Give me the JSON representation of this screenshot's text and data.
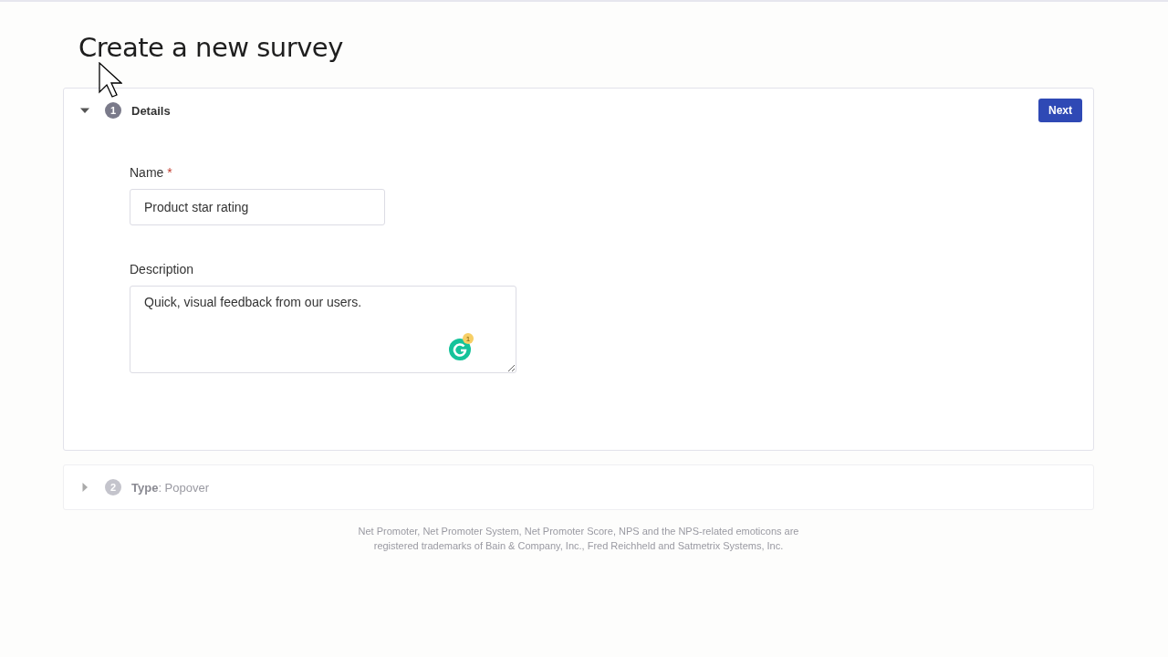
{
  "page": {
    "title": "Create a new survey"
  },
  "steps": [
    {
      "number": "1",
      "title": "Details",
      "expanded": true,
      "disabled": false,
      "action": "Next",
      "fields": [
        {
          "kind": "input",
          "label": "Name",
          "required_mark": "*",
          "value": "Product star rating"
        },
        {
          "kind": "textarea",
          "label": "Description",
          "value": "Quick, visual feedback from our users.",
          "badge_count": "1"
        }
      ]
    },
    {
      "number": "2",
      "title": "**Type**: Popover",
      "expanded": false,
      "disabled": true
    }
  ],
  "footer": {
    "note": "Net Promoter, Net Promoter System, Net Promoter Score, NPS and the NPS-related emoticons are registered trademarks of Bain & Company, Inc., Fred Reichheld and Satmetrix Systems, Inc."
  }
}
